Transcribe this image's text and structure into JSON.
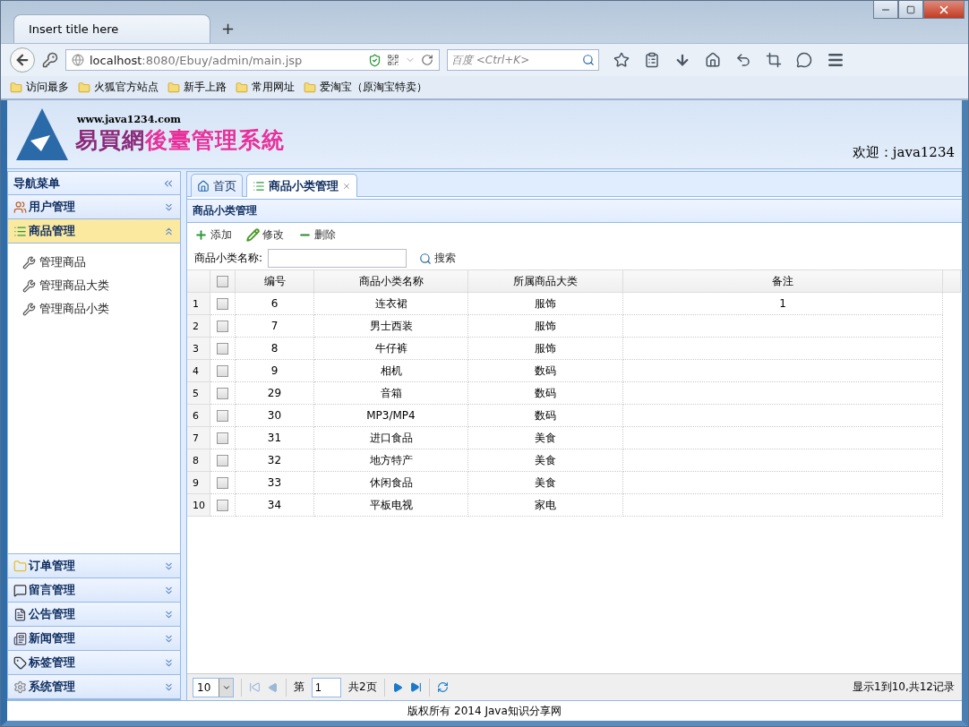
{
  "browser": {
    "tab_title": "Insert title here",
    "new_tab": "+",
    "url_host": "localhost",
    "url_path": ":8080/Ebuy/admin/main.jsp",
    "search_placeholder": "百度 <Ctrl+K>",
    "bookmarks": [
      "访问最多",
      "火狐官方站点",
      "新手上路",
      "常用网址",
      "爱淘宝（原淘宝特卖）"
    ]
  },
  "header": {
    "site": "www.java1234.com",
    "title_main": "易買網",
    "title_accent": "後臺管理系統",
    "welcome_label": "欢迎：",
    "user": "java1234"
  },
  "sidebar": {
    "title": "导航菜单",
    "groups": [
      {
        "label": "用户管理",
        "expanded": false,
        "selected": false
      },
      {
        "label": "商品管理",
        "expanded": true,
        "selected": true,
        "children": [
          {
            "label": "管理商品"
          },
          {
            "label": "管理商品大类"
          },
          {
            "label": "管理商品小类"
          }
        ]
      },
      {
        "label": "订单管理",
        "expanded": false,
        "selected": false
      },
      {
        "label": "留言管理",
        "expanded": false,
        "selected": false
      },
      {
        "label": "公告管理",
        "expanded": false,
        "selected": false
      },
      {
        "label": "新闻管理",
        "expanded": false,
        "selected": false
      },
      {
        "label": "标签管理",
        "expanded": false,
        "selected": false
      },
      {
        "label": "系统管理",
        "expanded": false,
        "selected": false
      }
    ]
  },
  "tabs": [
    {
      "label": "首页",
      "selected": false,
      "closable": false
    },
    {
      "label": "商品小类管理",
      "selected": true,
      "closable": true
    }
  ],
  "panel": {
    "title": "商品小类管理",
    "toolbar": [
      "添加",
      "修改",
      "删除"
    ],
    "search_label": "商品小类名称:",
    "search_button": "搜索"
  },
  "table": {
    "header_checked": false,
    "columns": [
      "编号",
      "商品小类名称",
      "所属商品大类",
      "备注"
    ],
    "rows": [
      {
        "num": "1",
        "checked": false,
        "cells": [
          "6",
          "连衣裙",
          "服饰",
          "1"
        ]
      },
      {
        "num": "2",
        "checked": false,
        "cells": [
          "7",
          "男士西装",
          "服饰"
        ]
      },
      {
        "num": "3",
        "checked": false,
        "cells": [
          "8",
          "牛仔裤",
          "服饰"
        ]
      },
      {
        "num": "4",
        "checked": false,
        "cells": [
          "9",
          "相机",
          "数码"
        ]
      },
      {
        "num": "5",
        "checked": false,
        "cells": [
          "29",
          "音箱",
          "数码"
        ]
      },
      {
        "num": "6",
        "checked": false,
        "cells": [
          "30",
          "MP3/MP4",
          "数码"
        ]
      },
      {
        "num": "7",
        "checked": false,
        "cells": [
          "31",
          "进口食品",
          "美食"
        ]
      },
      {
        "num": "8",
        "checked": false,
        "cells": [
          "32",
          "地方特产",
          "美食"
        ]
      },
      {
        "num": "9",
        "checked": false,
        "cells": [
          "33",
          "休闲食品",
          "美食"
        ]
      },
      {
        "num": "10",
        "checked": false,
        "cells": [
          "34",
          "平板电视",
          "家电"
        ]
      }
    ]
  },
  "pager": {
    "page_size": "10",
    "page_label": "第",
    "page": "1",
    "total_label": "共2页",
    "info": "显示1到10,共12记录"
  },
  "footer": "版权所有 2014 Java知识分享网"
}
